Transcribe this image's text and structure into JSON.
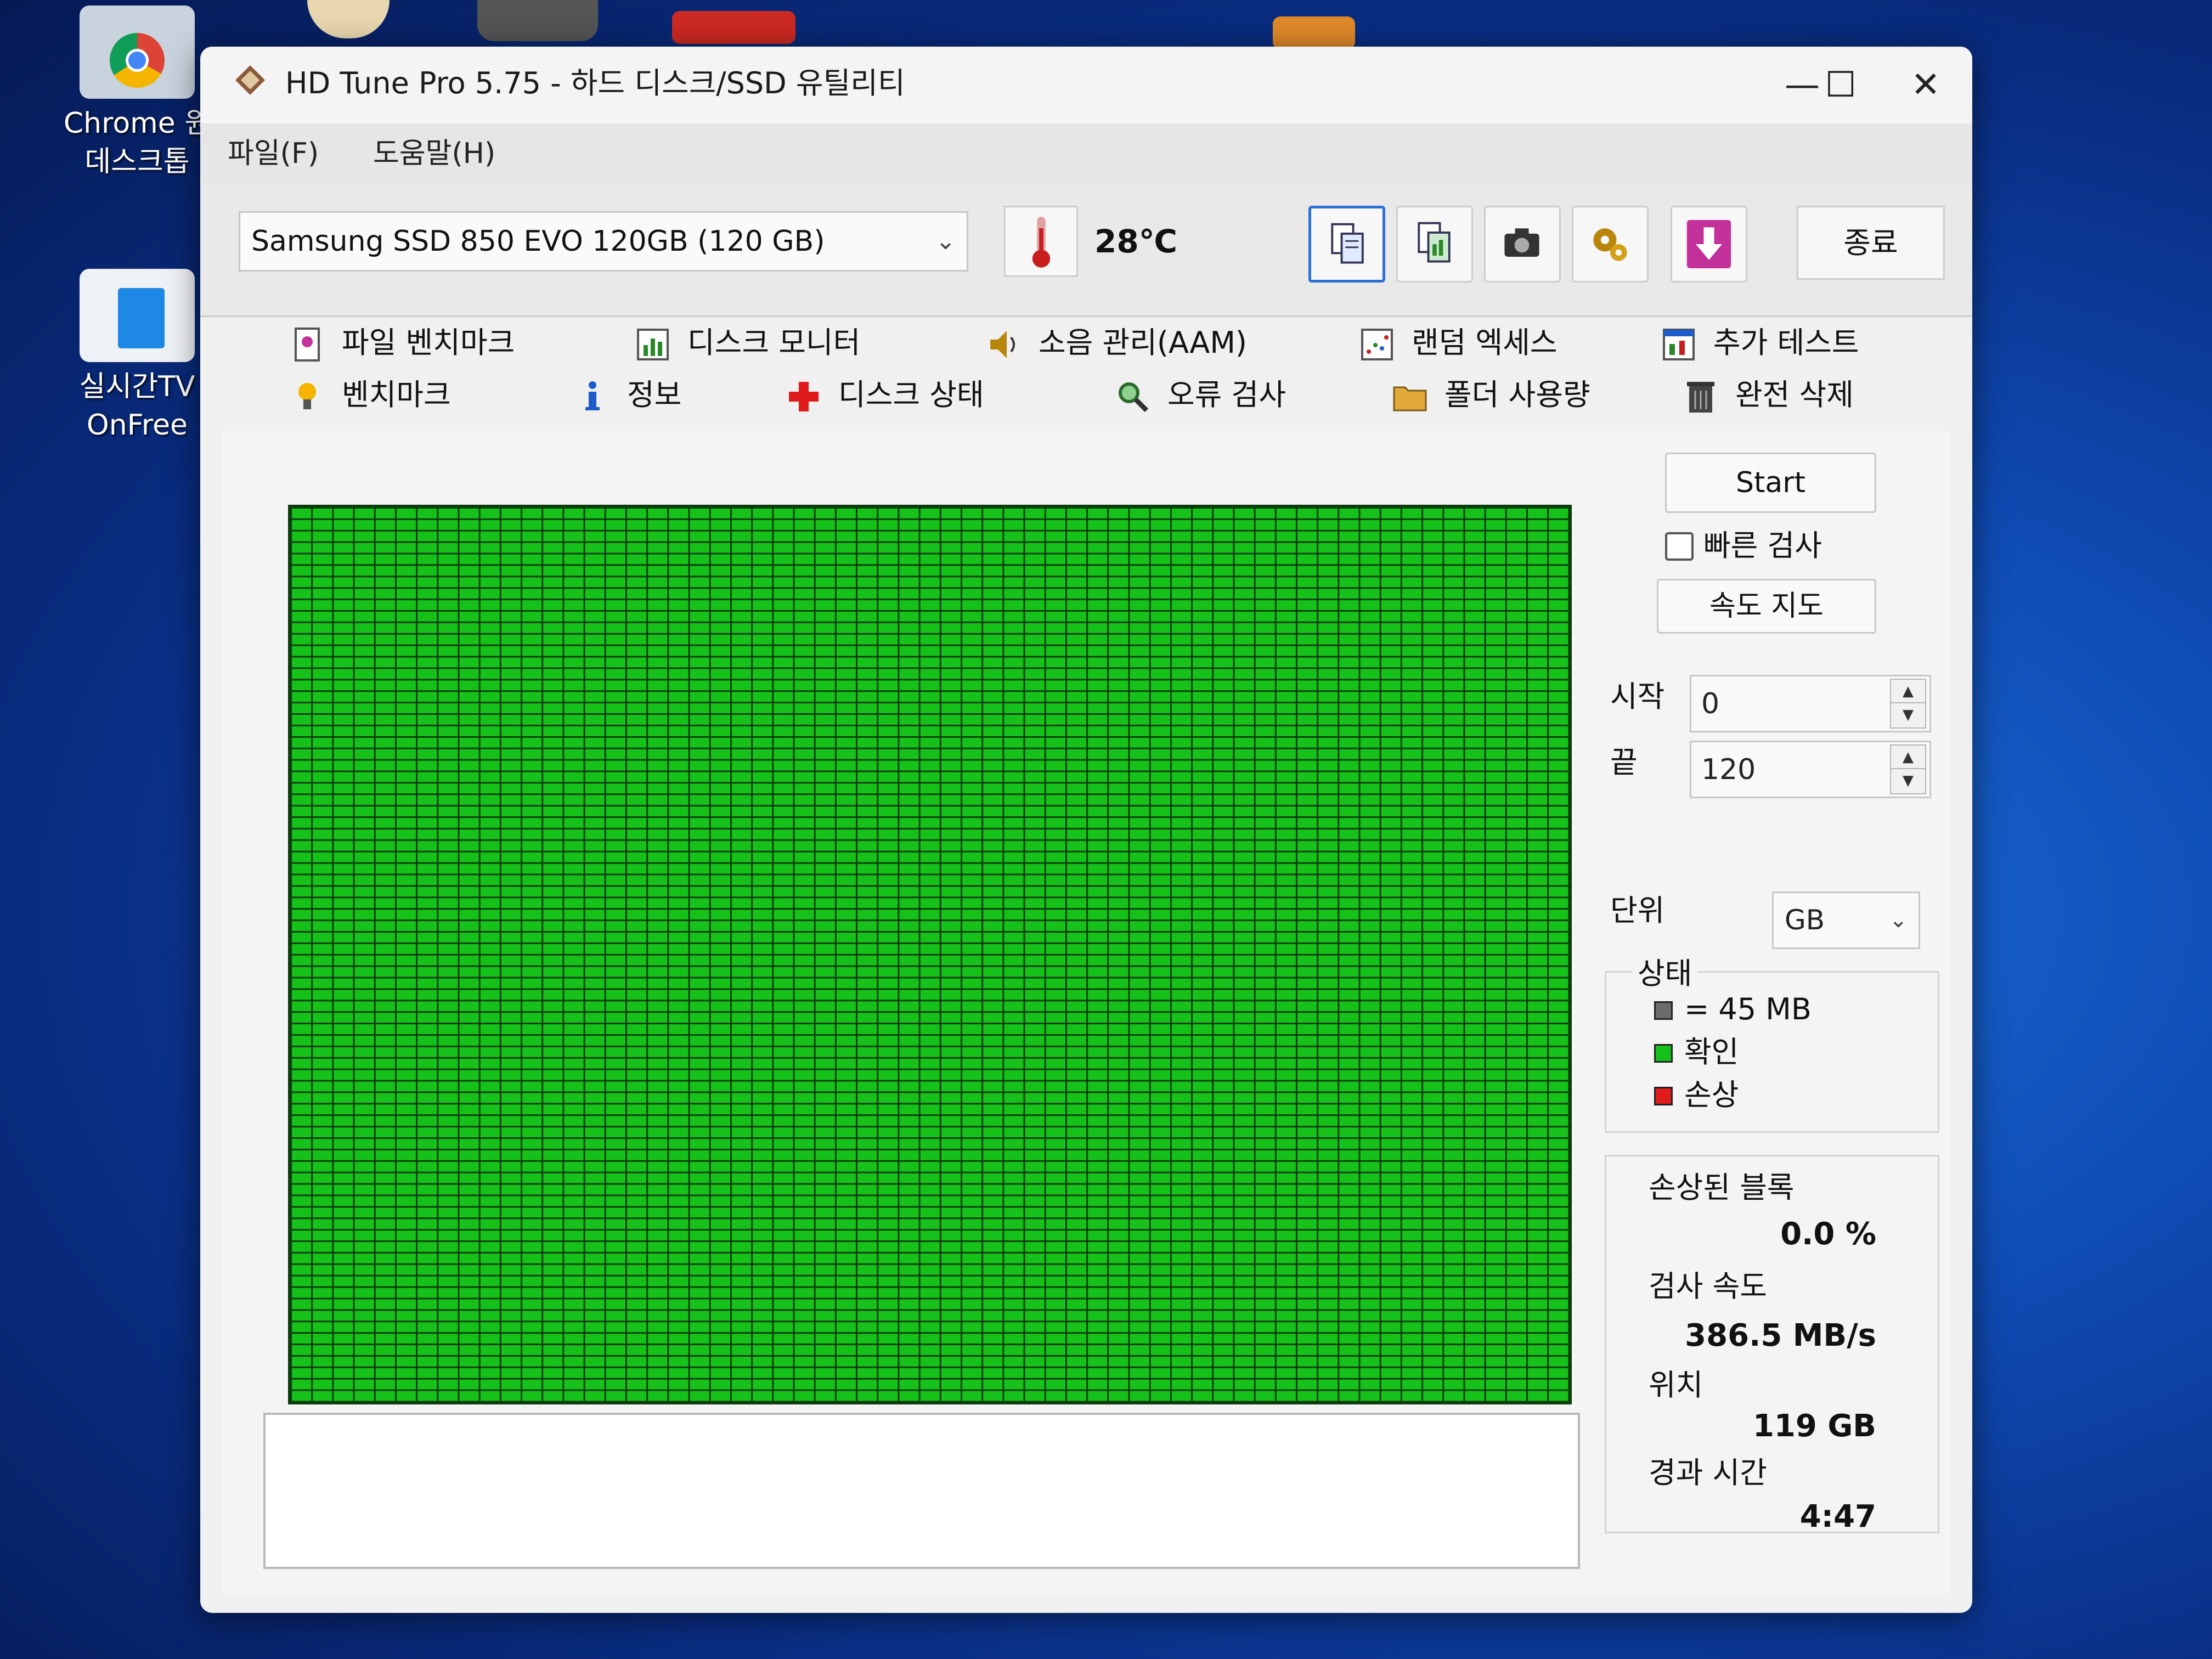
{
  "desktop": {
    "icons": [
      {
        "label_line1": "Chrome 원",
        "label_line2": "데스크톱"
      },
      {
        "label_line1": "실시간TV",
        "label_line2": "OnFree"
      }
    ]
  },
  "window": {
    "title": "HD Tune Pro 5.75 - 하드 디스크/SSD 유틸리티",
    "controls": {
      "minimize": "—",
      "maximize": "☐",
      "close": "✕"
    }
  },
  "menu": {
    "file": "파일(F)",
    "help": "도움말(H)"
  },
  "toolbar": {
    "drive": "Samsung SSD 850 EVO 120GB (120 GB)",
    "temperature": "28℃",
    "exit_label": "종료"
  },
  "tabs": {
    "row1": [
      "파일 벤치마크",
      "디스크 모니터",
      "소음 관리(AAM)",
      "랜덤 엑세스",
      "추가 테스트"
    ],
    "row2": [
      "벤치마크",
      "정보",
      "디스크 상태",
      "오류 검사",
      "폴더 사용량",
      "완전 삭제"
    ],
    "active": "오류 검사"
  },
  "error_scan": {
    "start_label": "Start",
    "quick_scan_label": "빠른 검사",
    "quick_scan_checked": false,
    "speed_map_label": "속도 지도",
    "start_field_label": "시작",
    "start_value": "0",
    "end_field_label": "끝",
    "end_value": "120",
    "unit_label": "단위",
    "unit_value": "GB",
    "status_group_label": "상태",
    "legend": {
      "block_size": "= 45 MB",
      "ok": "확인",
      "damaged": "손상"
    },
    "damaged_blocks_label": "손상된 블록",
    "damaged_blocks_value": "0.0 %",
    "scan_speed_label": "검사 속도",
    "scan_speed_value": "386.5 MB/s",
    "position_label": "위치",
    "position_value": "119 GB",
    "elapsed_label": "경과 시간",
    "elapsed_value": "4:47"
  },
  "colors": {
    "ok_block": "#16c21a",
    "grid_line": "#0a3d0b",
    "damaged_block": "#e01b1b",
    "block_size_swatch": "#6b6b6b",
    "accent": "#2d6fd8"
  }
}
